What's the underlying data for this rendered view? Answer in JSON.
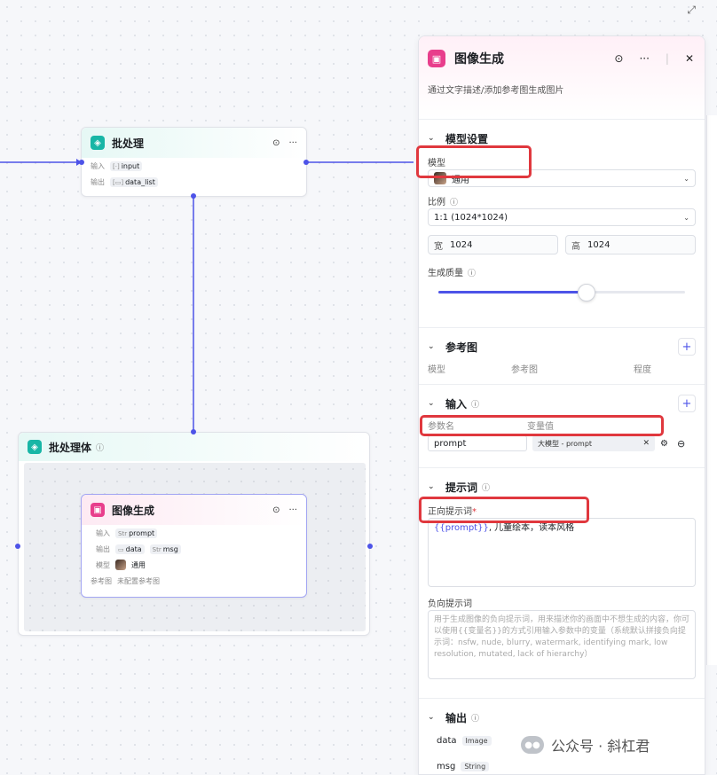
{
  "batch_node": {
    "title": "批处理",
    "input_label": "输入",
    "input_value": "input",
    "output_label": "输出",
    "output_value": "data_list"
  },
  "batch_body": {
    "title": "批处理体"
  },
  "image_node": {
    "title": "图像生成",
    "input_label": "输入",
    "input_value": "prompt",
    "output_label": "输出",
    "output_value_1": "data",
    "output_value_2": "msg",
    "model_label": "模型",
    "model_value": "通用",
    "ref_label": "参考图",
    "ref_value": "未配置参考图"
  },
  "panel": {
    "title": "图像生成",
    "description": "通过文字描述/添加参考图生成图片",
    "model_section": {
      "title": "模型设置",
      "model_label": "模型",
      "model_value": "通用",
      "ratio_label": "比例",
      "ratio_value": "1:1 (1024*1024)",
      "width_label": "宽",
      "width_value": "1024",
      "height_label": "高",
      "height_value": "1024",
      "quality_label": "生成质量",
      "quality_fraction": 0.6
    },
    "ref_section": {
      "title": "参考图",
      "col_model": "模型",
      "col_ref": "参考图",
      "col_degree": "程度"
    },
    "input_section": {
      "title": "输入",
      "col_name": "参数名",
      "col_value": "变量值",
      "param_name": "prompt",
      "param_value": "大模型 - prompt"
    },
    "prompt_section": {
      "title": "提示词",
      "positive_label": "正向提示词",
      "positive_var": "{{prompt}}",
      "positive_text": ", 儿童绘本，读本风格",
      "negative_label": "负向提示词",
      "negative_placeholder": "用于生成图像的负向提示词，用来描述你的画面中不想生成的内容，你可以使用{{变量名}}的方式引用输入参数中的变量（系统默认拼接负向提示词：nsfw, nude, blurry, watermark, identifying mark, low resolution, mutated, lack of hierarchy）"
    },
    "output_section": {
      "title": "输出",
      "out1_name": "data",
      "out1_type": "Image",
      "out2_name": "msg",
      "out2_type": "String"
    }
  },
  "watermark": "公众号 · 斜杠君",
  "colors": {
    "accent": "#4d53e8",
    "highlight": "#e0383e",
    "batch_icon": "#18b6a6",
    "image_icon": "#e83e8c"
  }
}
